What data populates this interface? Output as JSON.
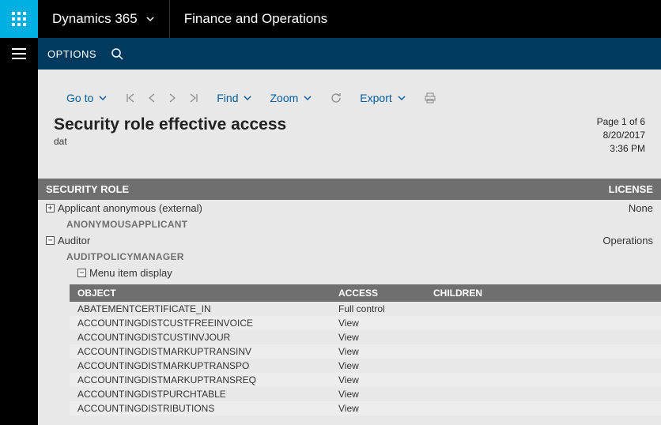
{
  "header": {
    "brand": "Dynamics 365",
    "module": "Finance and Operations"
  },
  "cmdbar": {
    "options": "OPTIONS"
  },
  "toolbar": {
    "goto": "Go to",
    "find": "Find",
    "zoom": "Zoom",
    "export": "Export"
  },
  "report": {
    "title": "Security role effective access",
    "subtitle": "dat",
    "page": "Page 1 of 6",
    "date": "8/20/2017",
    "time": "3:36 PM"
  },
  "band": {
    "role": "SECURITY ROLE",
    "license": "LICENSE"
  },
  "roles": [
    {
      "name": "Applicant anonymous (external)",
      "license": "None",
      "sys": "ANONYMOUSAPPLICANT",
      "expand": "+"
    },
    {
      "name": "Auditor",
      "license": "Operations",
      "sys": "AUDITPOLICYMANAGER",
      "expand": "−"
    }
  ],
  "menuGroup": {
    "label": "Menu item display",
    "expand": "−"
  },
  "subband": {
    "object": "OBJECT",
    "access": "ACCESS",
    "children": "CHILDREN"
  },
  "items": [
    {
      "obj": "ABATEMENTCERTIFICATE_IN",
      "access": "Full control"
    },
    {
      "obj": "ACCOUNTINGDISTCUSTFREEINVOICE",
      "access": "View"
    },
    {
      "obj": "ACCOUNTINGDISTCUSTINVJOUR",
      "access": "View"
    },
    {
      "obj": "ACCOUNTINGDISTMARKUPTRANSINV",
      "access": "View"
    },
    {
      "obj": "ACCOUNTINGDISTMARKUPTRANSPO",
      "access": "View"
    },
    {
      "obj": "ACCOUNTINGDISTMARKUPTRANSREQ",
      "access": "View"
    },
    {
      "obj": "ACCOUNTINGDISTPURCHTABLE",
      "access": "View"
    },
    {
      "obj": "ACCOUNTINGDISTRIBUTIONS",
      "access": "View"
    }
  ]
}
